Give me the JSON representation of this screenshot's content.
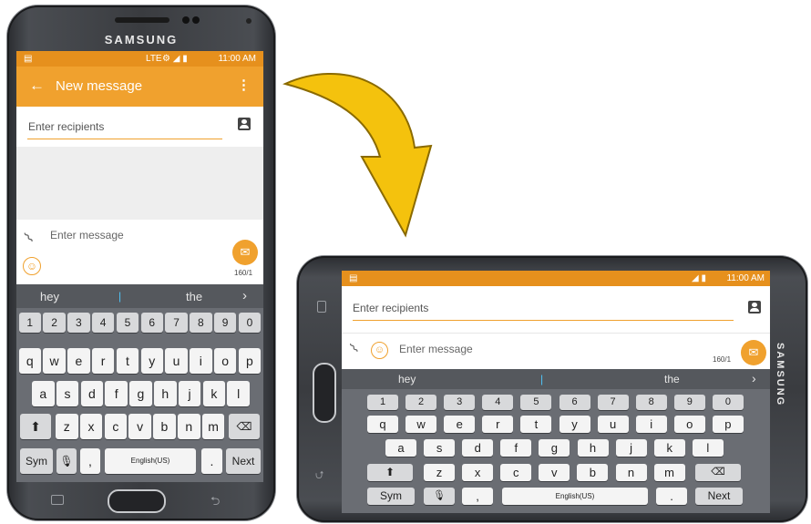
{
  "portrait": {
    "brand": "SAMSUNG",
    "status": {
      "network": "LTE",
      "time": "11:00 AM"
    },
    "appbar": {
      "title": "New message"
    },
    "recipients_placeholder": "Enter recipients",
    "message_placeholder": "Enter message",
    "char_count": "160/1",
    "suggestions": [
      "hey",
      "|",
      "the"
    ],
    "rows": {
      "numbers": [
        "1",
        "2",
        "3",
        "4",
        "5",
        "6",
        "7",
        "8",
        "9",
        "0"
      ],
      "top": [
        "q",
        "w",
        "e",
        "r",
        "t",
        "y",
        "u",
        "i",
        "o",
        "p"
      ],
      "middle": [
        "a",
        "s",
        "d",
        "f",
        "g",
        "h",
        "j",
        "k",
        "l"
      ],
      "bottom": [
        "z",
        "x",
        "c",
        "v",
        "b",
        "n",
        "m"
      ]
    },
    "sym_label": "Sym",
    "comma": ",",
    "space_label": "English(US)",
    "period": ".",
    "next_label": "Next"
  },
  "landscape": {
    "brand": "SAMSUNG",
    "status": {
      "time": "11:00 AM"
    },
    "recipients_placeholder": "Enter recipients",
    "message_placeholder": "Enter message",
    "char_count": "160/1",
    "suggestions": [
      "hey",
      "|",
      "the"
    ],
    "sym_label": "Sym",
    "comma": ",",
    "space_label": "English(US)",
    "period": ".",
    "next_label": "Next"
  },
  "colors": {
    "status_orange": "#e6901d",
    "appbar_orange": "#f0a12e",
    "arrow_yellow": "#f4c20d"
  }
}
